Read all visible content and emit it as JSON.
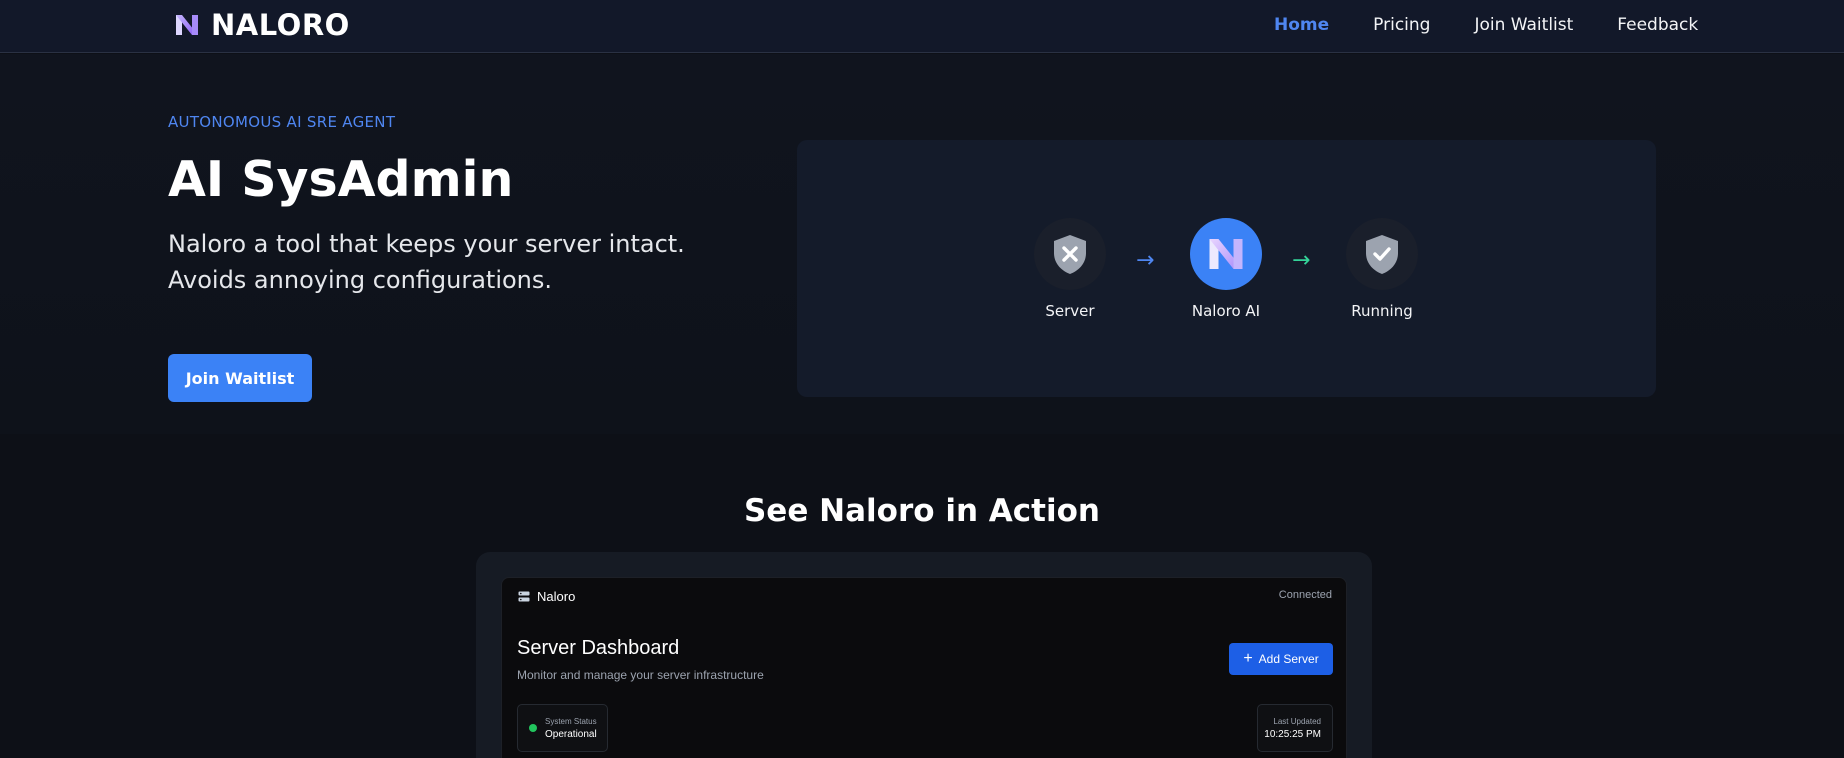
{
  "nav": {
    "brand": "NALORO",
    "links": [
      {
        "label": "Home",
        "active": true
      },
      {
        "label": "Pricing",
        "active": false
      },
      {
        "label": "Join Waitlist",
        "active": false
      },
      {
        "label": "Feedback",
        "active": false
      }
    ]
  },
  "hero": {
    "eyebrow": "AUTONOMOUS AI SRE AGENT",
    "title": "AI SysAdmin",
    "subtitle": "Naloro a tool that keeps your server intact. Avoids annoying configurations.",
    "cta_label": "Join Waitlist"
  },
  "flow": {
    "nodes": [
      {
        "label": "Server",
        "icon": "shield-x-icon"
      },
      {
        "label": "Naloro AI",
        "icon": "naloro-logo-icon"
      },
      {
        "label": "Running",
        "icon": "shield-check-icon"
      }
    ],
    "arrows": [
      {
        "glyph": "→",
        "color": "#4f86f0"
      },
      {
        "glyph": "→",
        "color": "#34d399"
      }
    ]
  },
  "demo": {
    "section_title": "See Naloro in Action",
    "app_name": "Naloro",
    "connection": "Connected",
    "title": "Server Dashboard",
    "subtitle": "Monitor and manage your server infrastructure",
    "add_button": "Add Server",
    "status_label": "System Status",
    "status_value": "Operational",
    "updated_label": "Last Updated",
    "updated_value": "10:25:25 PM"
  },
  "colors": {
    "accent": "#3b82f6",
    "link_active": "#4f86f0",
    "status_ok": "#22c55e",
    "arrow_green": "#34d399",
    "background": "#0d1017"
  }
}
